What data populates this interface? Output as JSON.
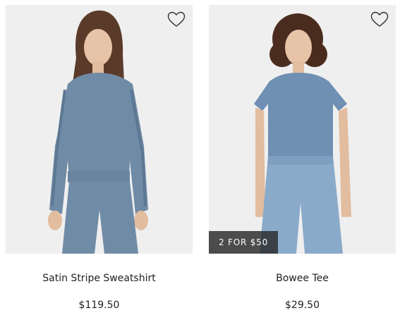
{
  "products": [
    {
      "name": "Satin Stripe Sweatshirt",
      "price": "$119.50",
      "image_icon": "sweatshirt-model-photo",
      "wishlist_icon": "heart-icon",
      "badge": null,
      "colors": {
        "garment": "#6f8ba6",
        "background": "#efefef"
      }
    },
    {
      "name": "Bowee Tee",
      "price": "$29.50",
      "image_icon": "tee-model-photo",
      "wishlist_icon": "heart-icon",
      "badge": "2 FOR $50",
      "colors": {
        "garment": "#6f8fb3",
        "jeans": "#8aaac9",
        "background": "#efefef"
      }
    }
  ]
}
